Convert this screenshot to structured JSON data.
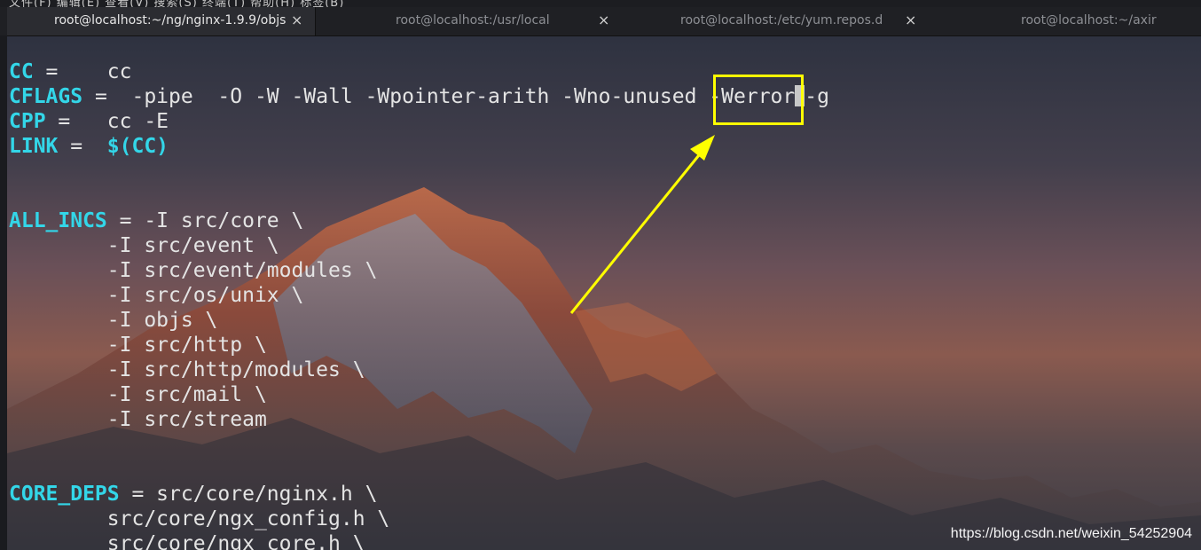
{
  "window": {
    "tabs": [
      {
        "label": "root@localhost:~/ng/nginx-1.9.9/objs",
        "active": true
      },
      {
        "label": "root@localhost:/usr/local",
        "active": false
      },
      {
        "label": "root@localhost:/etc/yum.repos.d",
        "active": false
      },
      {
        "label": "root@localhost:~/axir",
        "active": false
      }
    ],
    "close_glyph": "×"
  },
  "terminal": {
    "lines": [
      {
        "key": "CC",
        "rest": " =    cc"
      },
      {
        "key": "CFLAGS",
        "rest": " =  -pipe  -O -W -Wall -Wpointer-arith -Wno-unused -Werror"
      },
      {
        "key": "CPP",
        "rest": " =   cc -E"
      },
      {
        "key": "LINK",
        "rest": " =  ",
        "value": "$(CC)"
      },
      {
        "key": "",
        "rest": ""
      },
      {
        "key": "",
        "rest": ""
      },
      {
        "key": "ALL_INCS",
        "rest": " = -I src/core \\"
      },
      {
        "key": "",
        "rest": "        -I src/event \\"
      },
      {
        "key": "",
        "rest": "        -I src/event/modules \\"
      },
      {
        "key": "",
        "rest": "        -I src/os/unix \\"
      },
      {
        "key": "",
        "rest": "        -I objs \\"
      },
      {
        "key": "",
        "rest": "        -I src/http \\"
      },
      {
        "key": "",
        "rest": "        -I src/http/modules \\"
      },
      {
        "key": "",
        "rest": "        -I src/mail \\"
      },
      {
        "key": "",
        "rest": "        -I src/stream"
      },
      {
        "key": "",
        "rest": ""
      },
      {
        "key": "",
        "rest": ""
      },
      {
        "key": "CORE_DEPS",
        "rest": " = src/core/nginx.h \\"
      },
      {
        "key": "",
        "rest": "        src/core/ngx_config.h \\"
      },
      {
        "key": "",
        "rest": "        src/core/ngx_core.h \\"
      }
    ],
    "cflags_tail": "-g",
    "highlighted_text": "-Werror"
  },
  "watermark": "https://blog.csdn.net/weixin_54252904",
  "colors": {
    "keyword": "#33d6e8",
    "highlight": "#ffff00",
    "text": "#e4e4e4"
  }
}
